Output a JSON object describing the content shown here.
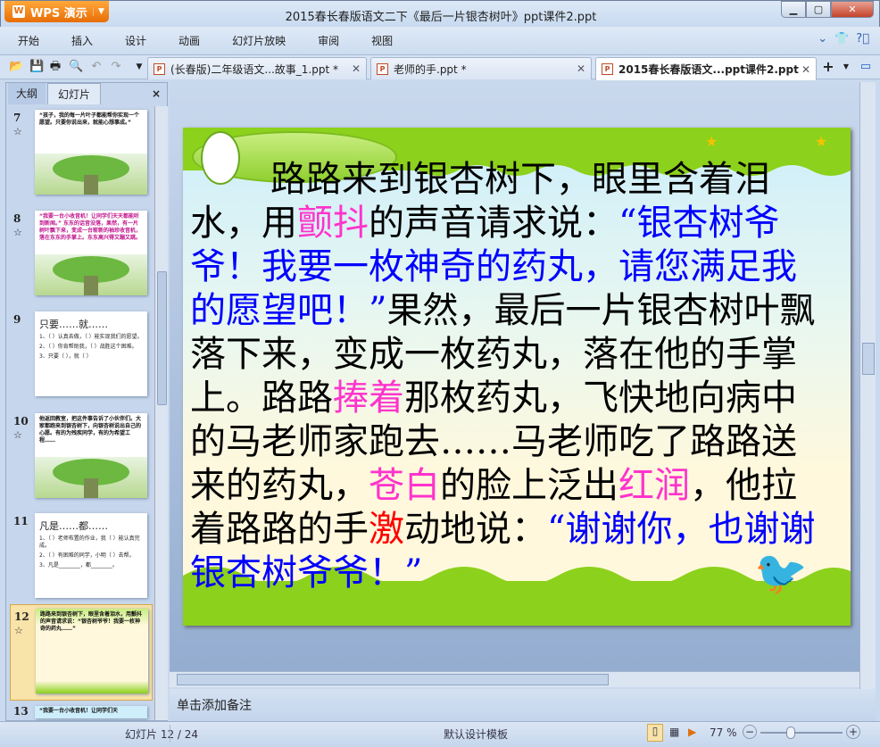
{
  "app": {
    "name": "WPS 演示",
    "title": "2015春长春版语文二下《最后一片银杏树叶》ppt课件2.ppt"
  },
  "menu": [
    "开始",
    "插入",
    "设计",
    "动画",
    "幻灯片放映",
    "审阅",
    "视图"
  ],
  "doc_tabs": [
    {
      "label": "(长春版)二年级语文...故事_1.ppt *",
      "active": false
    },
    {
      "label": "老师的手.ppt *",
      "active": false
    },
    {
      "label": "2015春长春版语文...ppt课件2.ppt",
      "active": true
    }
  ],
  "panel": {
    "tabs": [
      "大纲",
      "幻灯片"
    ],
    "close": "×"
  },
  "thumbnails": [
    {
      "num": "7",
      "text": "“孩子，我的每一片叶子都能帮你实现一个愿望。只要你说出来，就能心想事成。”"
    },
    {
      "num": "8",
      "text": "“我要一台小收音机！让同学们天天都能听到新闻。” 东东的话音没落，果然，有一片树叶飘下来，变成一台崭新的袖珍收音机，落在东东的手掌上。东东高兴得又蹦又跳。"
    },
    {
      "num": "9",
      "title": "只要……就……",
      "items": [
        "1、（ ）认真去做，（ ）能实现我们的愿望。",
        "2、（ ）你肯帮助我，（ ）战胜这个困难。",
        "3、只要（ ），就（ ）"
      ]
    },
    {
      "num": "10",
      "text": "他返回教室，把这件事告诉了小伙伴们。大家都跑来到银杏树下，向银杏树说出自己的心愿。有的为残疾同学，有的为希望工程……"
    },
    {
      "num": "11",
      "title": "凡是……都……",
      "items": [
        "1、（ ）老师布置的作业，我（ ）能认真完成。",
        "2、（ ）有困难的同学，小明（ ）去帮。",
        "3、凡是________，都________。"
      ]
    },
    {
      "num": "12",
      "text": "路路来到银杏树下，眼里含着泪水，用颤抖的声音请求说：“银杏树爷爷！我要一枚神奇的药丸……”"
    },
    {
      "num": "13",
      "text": "“我要一台小收音机！让同学们天"
    }
  ],
  "slide": {
    "lines": [
      [
        {
          "t": "路路来到银杏树下，眼里含着泪",
          "c": "#000000"
        }
      ],
      [
        {
          "t": "水，用",
          "c": "#000000"
        },
        {
          "t": "颤抖",
          "c": "#ff33cc"
        },
        {
          "t": "的声音请求说：",
          "c": "#000000"
        },
        {
          "t": "“银杏树爷",
          "c": "#0000ff"
        }
      ],
      [
        {
          "t": "爷！我要一枚神奇的药丸，请您满足我",
          "c": "#0000ff"
        }
      ],
      [
        {
          "t": "的愿望吧！”",
          "c": "#0000ff"
        },
        {
          "t": "果然，最后一片银杏树叶飘",
          "c": "#000000"
        }
      ],
      [
        {
          "t": "落下来，变成一枚药丸，落在他的手掌",
          "c": "#000000"
        }
      ],
      [
        {
          "t": "上。路路",
          "c": "#000000"
        },
        {
          "t": "捧着",
          "c": "#ff33cc"
        },
        {
          "t": "那枚药丸，飞快地向病中",
          "c": "#000000"
        }
      ],
      [
        {
          "t": "的马老师家跑去……马老师吃了路路送",
          "c": "#000000"
        }
      ],
      [
        {
          "t": "来的药丸，",
          "c": "#000000"
        },
        {
          "t": "苍白",
          "c": "#ff33cc"
        },
        {
          "t": "的脸上泛出",
          "c": "#000000"
        },
        {
          "t": "红润",
          "c": "#ff33cc"
        },
        {
          "t": "，他拉",
          "c": "#000000"
        }
      ],
      [
        {
          "t": "着路路的手",
          "c": "#000000"
        },
        {
          "t": "激",
          "c": "#ff0000"
        },
        {
          "t": "动地说：",
          "c": "#000000"
        },
        {
          "t": "“谢谢你，也谢谢",
          "c": "#0000ff"
        }
      ],
      [
        {
          "t": "银杏树爷爷！”",
          "c": "#0000ff"
        }
      ]
    ]
  },
  "notes_placeholder": "单击添加备注",
  "status": {
    "slide_counter": "幻灯片 12 / 24",
    "template": "默认设计模板",
    "zoom": "77 %",
    "zoom_level": 77
  }
}
